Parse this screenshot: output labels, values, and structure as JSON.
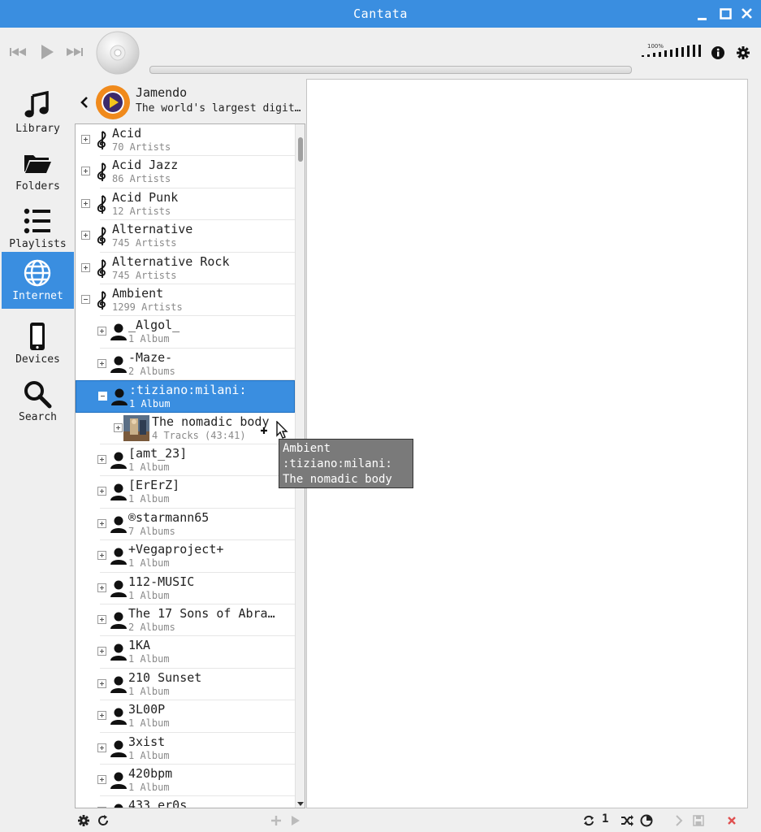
{
  "window": {
    "title": "Cantata"
  },
  "toolbar": {
    "volume_label": "100%"
  },
  "sidebar": {
    "items": [
      {
        "label": "Library",
        "icon": "music-note-icon"
      },
      {
        "label": "Folders",
        "icon": "folder-icon"
      },
      {
        "label": "Playlists",
        "icon": "list-icon"
      },
      {
        "label": "Internet",
        "icon": "globe-icon",
        "active": true
      },
      {
        "label": "Devices",
        "icon": "phone-icon"
      },
      {
        "label": "Search",
        "icon": "search-icon"
      }
    ]
  },
  "service": {
    "name": "Jamendo",
    "description": "The world's largest digit…"
  },
  "tree": {
    "rows": [
      {
        "title": "Acid",
        "subtitle": "70 Artists",
        "level": 0,
        "kind": "genre",
        "expanded": false
      },
      {
        "title": "Acid Jazz",
        "subtitle": "86 Artists",
        "level": 0,
        "kind": "genre",
        "expanded": false
      },
      {
        "title": "Acid Punk",
        "subtitle": "12 Artists",
        "level": 0,
        "kind": "genre",
        "expanded": false
      },
      {
        "title": "Alternative",
        "subtitle": "745 Artists",
        "level": 0,
        "kind": "genre",
        "expanded": false
      },
      {
        "title": "Alternative Rock",
        "subtitle": "745 Artists",
        "level": 0,
        "kind": "genre",
        "expanded": false
      },
      {
        "title": "Ambient",
        "subtitle": "1299 Artists",
        "level": 0,
        "kind": "genre",
        "expanded": true
      },
      {
        "title": "_Algol_",
        "subtitle": "1 Album",
        "level": 1,
        "kind": "artist",
        "expanded": false
      },
      {
        "title": "-Maze-",
        "subtitle": "2 Albums",
        "level": 1,
        "kind": "artist",
        "expanded": false
      },
      {
        "title": ":tiziano:milani:",
        "subtitle": "1 Album",
        "level": 1,
        "kind": "artist",
        "expanded": true,
        "selected": true
      },
      {
        "title": "The nomadic  body",
        "subtitle": "4 Tracks (43:41)",
        "level": 2,
        "kind": "album",
        "expanded": false
      },
      {
        "title": "[amt_23]",
        "subtitle": "1 Album",
        "level": 1,
        "kind": "artist",
        "expanded": false
      },
      {
        "title": "[ErErZ]",
        "subtitle": "1 Album",
        "level": 1,
        "kind": "artist",
        "expanded": false
      },
      {
        "title": "®starmann65",
        "subtitle": "7 Albums",
        "level": 1,
        "kind": "artist",
        "expanded": false
      },
      {
        "title": "+Vegaproject+",
        "subtitle": "1 Album",
        "level": 1,
        "kind": "artist",
        "expanded": false
      },
      {
        "title": "112-MUSIC",
        "subtitle": "1 Album",
        "level": 1,
        "kind": "artist",
        "expanded": false
      },
      {
        "title": "The 17 Sons of Abra…",
        "subtitle": "2 Albums",
        "level": 1,
        "kind": "artist",
        "expanded": false
      },
      {
        "title": "1KA",
        "subtitle": "1 Album",
        "level": 1,
        "kind": "artist",
        "expanded": false
      },
      {
        "title": "210 Sunset",
        "subtitle": "1 Album",
        "level": 1,
        "kind": "artist",
        "expanded": false
      },
      {
        "title": "3L00P",
        "subtitle": "1 Album",
        "level": 1,
        "kind": "artist",
        "expanded": false
      },
      {
        "title": "3xist",
        "subtitle": "1 Album",
        "level": 1,
        "kind": "artist",
        "expanded": false
      },
      {
        "title": "420bpm",
        "subtitle": "1 Album",
        "level": 1,
        "kind": "artist",
        "expanded": false
      },
      {
        "title": "433 er0s",
        "subtitle": "",
        "level": 1,
        "kind": "artist",
        "expanded": false
      }
    ]
  },
  "tooltip": {
    "line1": "Ambient",
    "line2": ":tiziano:milani:",
    "line3": "The nomadic body"
  },
  "bottombar": {
    "count": "1"
  },
  "colors": {
    "accent": "#3a8ee0",
    "close": "#e05050"
  }
}
